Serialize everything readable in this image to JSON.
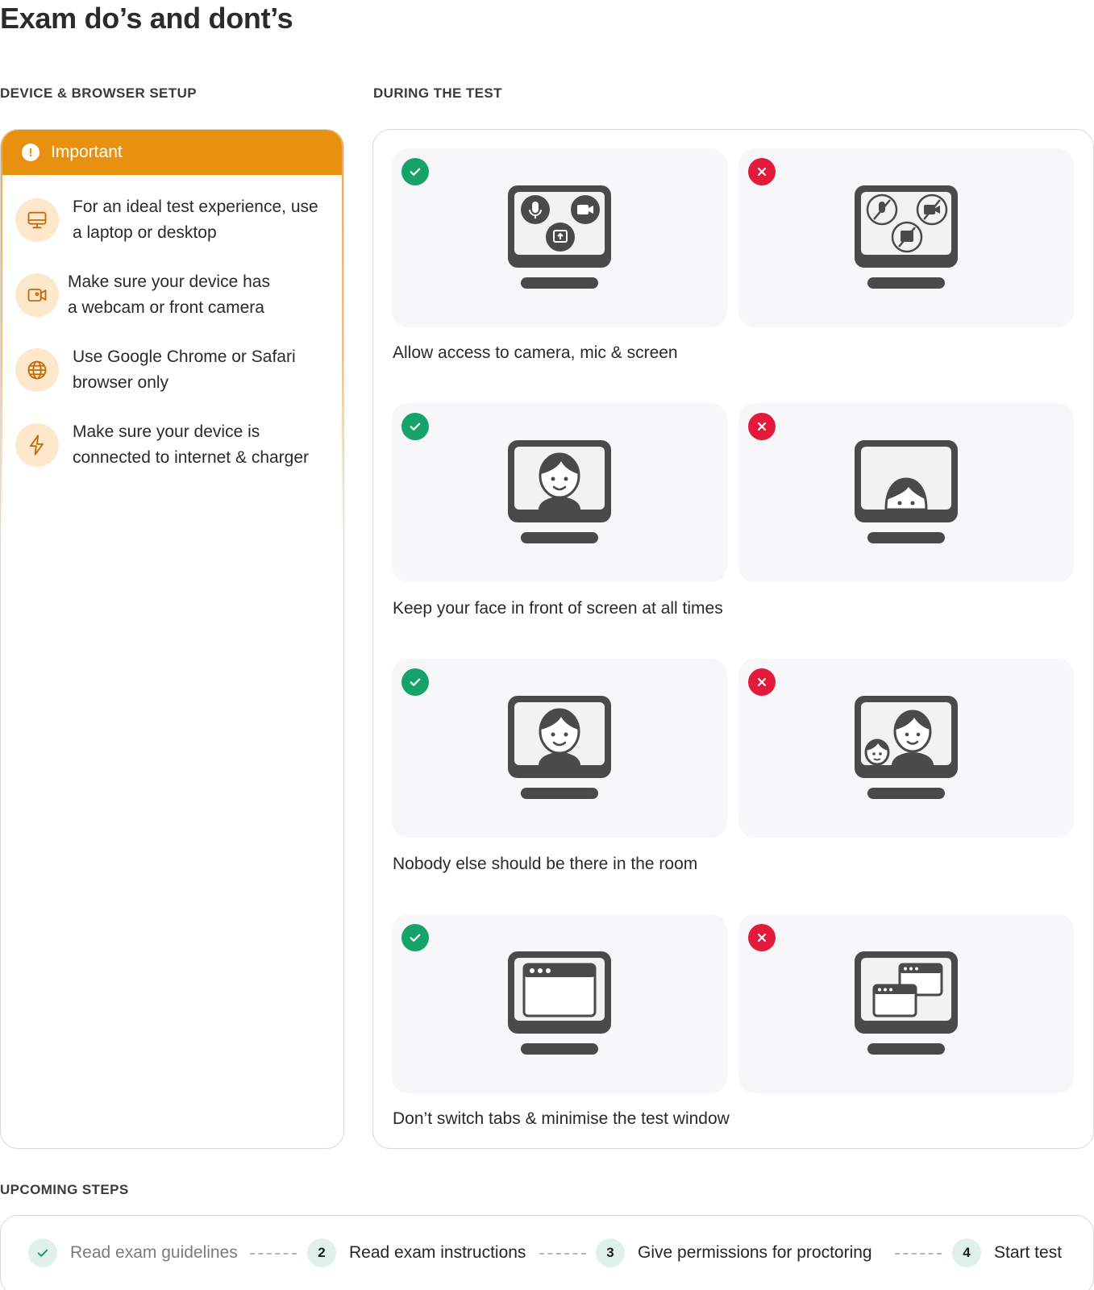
{
  "page": {
    "title": "Exam do’s and dont’s"
  },
  "sections": {
    "setup_label": "DEVICE & BROWSER SETUP",
    "during_label": "DURING THE TEST",
    "upcoming_label": "UPCOMING STEPS"
  },
  "important": {
    "title": "Important",
    "tips": [
      {
        "icon": "desktop-icon",
        "text": "For an ideal test experience, use\na laptop or desktop"
      },
      {
        "icon": "webcam-icon",
        "text": "Make sure your device has\na webcam or front camera"
      },
      {
        "icon": "globe-icon",
        "text": "Use Google Chrome or Safari\nbrowser only"
      },
      {
        "icon": "lightning-icon",
        "text": "Make sure your device is\nconnected to internet & charger"
      }
    ]
  },
  "rules": [
    {
      "caption": "Allow access to camera, mic & screen",
      "do_icon": "permissions-enabled-icon",
      "dont_icon": "permissions-disabled-icon"
    },
    {
      "caption": "Keep your face in front of screen at all times",
      "do_icon": "face-centered-icon",
      "dont_icon": "face-hidden-icon"
    },
    {
      "caption": "Nobody else should be there in the room",
      "do_icon": "single-person-icon",
      "dont_icon": "multiple-people-icon"
    },
    {
      "caption": "Don’t switch tabs & minimise the test window",
      "do_icon": "single-window-icon",
      "dont_icon": "multiple-windows-icon"
    }
  ],
  "steps": [
    {
      "number": "",
      "label": "Read exam guidelines",
      "status": "done"
    },
    {
      "number": "2",
      "label": "Read exam instructions",
      "status": "pending"
    },
    {
      "number": "3",
      "label": "Give permissions for proctoring",
      "status": "pending"
    },
    {
      "number": "4",
      "label": "Start test",
      "status": "pending"
    }
  ],
  "colors": {
    "accent": "#e8900f",
    "success": "#16a36a",
    "error": "#e21b3c",
    "tile_bg": "#f7f7f9",
    "step_bg": "#dff1ea"
  }
}
